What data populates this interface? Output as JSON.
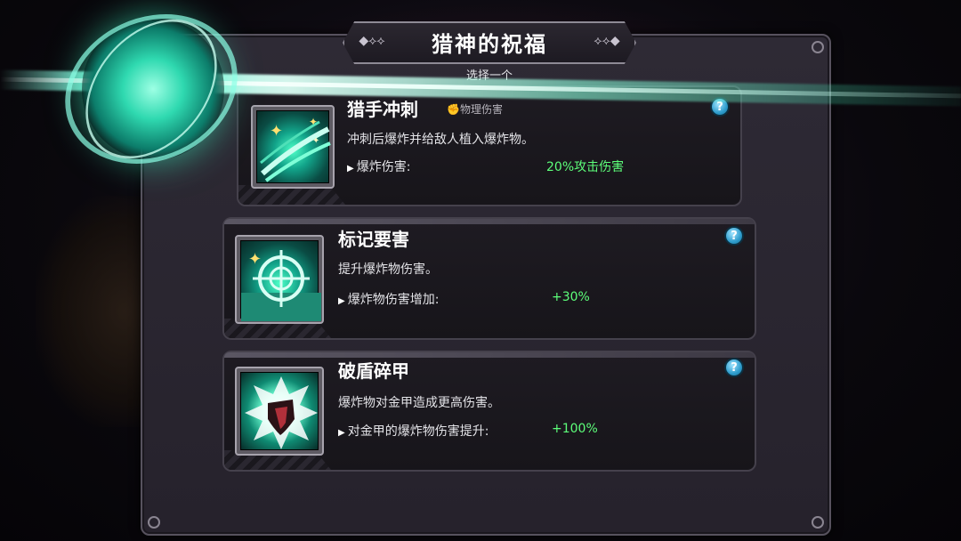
{
  "dialog": {
    "title": "猎神的祝福",
    "subtitle": "选择一个"
  },
  "cards": [
    {
      "title": "猎手冲刺",
      "tag": "物理伤害",
      "description": "冲刺后爆炸并给敌人植入爆炸物。",
      "stat_label": "爆炸伤害:",
      "stat_value": "20%攻击伤害",
      "help": "?"
    },
    {
      "title": "标记要害",
      "description": "提升爆炸物伤害。",
      "stat_label": "爆炸物伤害增加:",
      "stat_value": "+30%",
      "help": "?"
    },
    {
      "title": "破盾碎甲",
      "description": "爆炸物对金甲造成更高伤害。",
      "stat_label": "对金甲的爆炸物伤害提升:",
      "stat_value": "+100%",
      "help": "?"
    }
  ],
  "colors": {
    "stat_value": "#5dff7a",
    "help_button": "#2e9ccc",
    "beam": "#8cffe6"
  },
  "icons": [
    "dash-sparkle-icon",
    "crosshair-target-icon",
    "broken-shield-icon",
    "fist-icon",
    "help-icon"
  ]
}
